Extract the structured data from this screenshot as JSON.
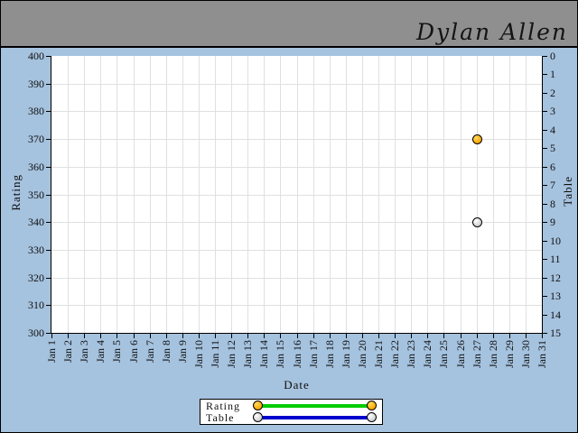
{
  "header": {
    "title": "Dylan Allen"
  },
  "chart_data": {
    "type": "scatter",
    "title": "Dylan Allen",
    "xlabel": "Date",
    "x_categories": [
      "Jan 1",
      "Jan 2",
      "Jan 3",
      "Jan 4",
      "Jan 5",
      "Jan 6",
      "Jan 7",
      "Jan 8",
      "Jan 9",
      "Jan 10",
      "Jan 11",
      "Jan 12",
      "Jan 13",
      "Jan 14",
      "Jan 15",
      "Jan 16",
      "Jan 17",
      "Jan 18",
      "Jan 19",
      "Jan 20",
      "Jan 21",
      "Jan 22",
      "Jan 23",
      "Jan 24",
      "Jan 25",
      "Jan 26",
      "Jan 27",
      "Jan 28",
      "Jan 29",
      "Jan 30",
      "Jan 31"
    ],
    "left_axis": {
      "label": "Rating",
      "min": 300,
      "max": 400,
      "tick_step": 10,
      "direction": "max-at-top"
    },
    "right_axis": {
      "label": "Table",
      "min": 0,
      "max": 15,
      "tick_step": 1,
      "direction": "min-at-top"
    },
    "grid": true,
    "legend_position": "bottom-center",
    "series": [
      {
        "name": "Rating",
        "axis": "left",
        "marker_color": "#ffaa00",
        "marker_highlight": "#ffd966",
        "line_color": "#00cc00",
        "points": [
          {
            "date": "Jan 27",
            "value": 370
          }
        ]
      },
      {
        "name": "Table",
        "axis": "right",
        "marker_color": "#d3d3d3",
        "marker_highlight": "#ffffff",
        "line_color": "#0000cc",
        "points": [
          {
            "date": "Jan 27",
            "value": 9
          }
        ]
      }
    ]
  },
  "legend": {
    "items": [
      {
        "label": "Rating"
      },
      {
        "label": "Table"
      }
    ]
  },
  "colors": {
    "background": "#a5c2de",
    "header_bg": "#8f8f8f",
    "plot_bg": "#ffffff",
    "grid": "#e0e0e0",
    "axis": "#000000"
  }
}
